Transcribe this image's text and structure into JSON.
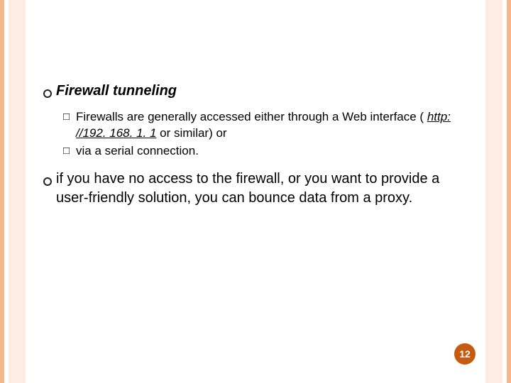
{
  "slide": {
    "bullets": [
      {
        "title": "Firewall tunneling",
        "sub": [
          {
            "pre": "Firewalls are generally accessed either through a Web interface ( ",
            "url": "http: //192. 168. 1. 1",
            "post": "  or similar) or"
          },
          {
            "pre": "via a serial connection.",
            "url": "",
            "post": ""
          }
        ]
      },
      {
        "title": "",
        "body": "if you have no access to the firewall, or you want to provide a user-friendly solution, you can bounce data from a proxy."
      }
    ],
    "page_number": "12"
  }
}
